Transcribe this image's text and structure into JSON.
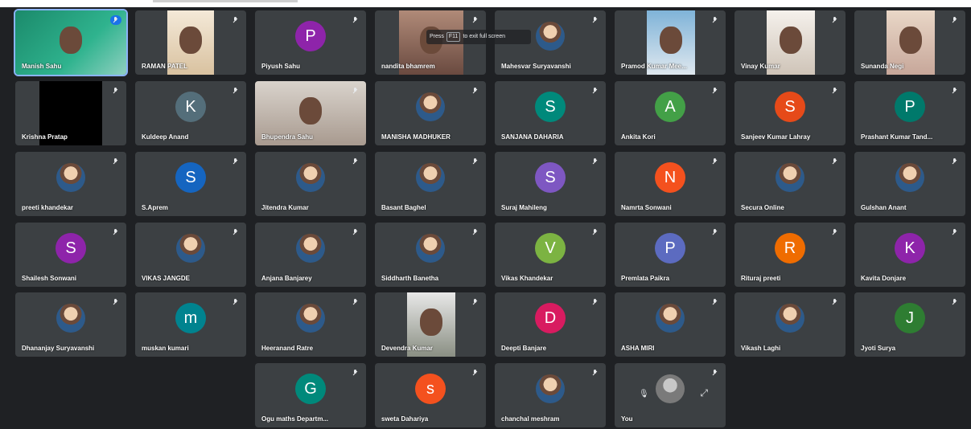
{
  "tooltip": {
    "prefix": "Press",
    "key": "F11",
    "suffix": "to exit full screen"
  },
  "participants": [
    {
      "name": "Manish Sahu",
      "kind": "video"
    },
    {
      "name": "RAMAN PATEL",
      "kind": "video"
    },
    {
      "name": "Piyush Sahu",
      "kind": "initial",
      "initial": "P",
      "color": "#8e24aa"
    },
    {
      "name": "nandita bhamrem",
      "kind": "video"
    },
    {
      "name": "Mahesvar Suryavanshi",
      "kind": "photo"
    },
    {
      "name": "Pramod Kumar Mee...",
      "kind": "video"
    },
    {
      "name": "Vinay Kumar",
      "kind": "video"
    },
    {
      "name": "Sunanda Negi",
      "kind": "video"
    },
    {
      "name": "Krishna Pratap",
      "kind": "black"
    },
    {
      "name": "Kuldeep Anand",
      "kind": "initial",
      "initial": "K",
      "color": "#546e7a"
    },
    {
      "name": "Bhupendra Sahu",
      "kind": "video"
    },
    {
      "name": "MANISHA MADHUKER",
      "kind": "photo"
    },
    {
      "name": "SANJANA DAHARIA",
      "kind": "initial",
      "initial": "S",
      "color": "#00897b"
    },
    {
      "name": "Ankita Kori",
      "kind": "initial",
      "initial": "A",
      "color": "#43a047"
    },
    {
      "name": "Sanjeev Kumar Lahray",
      "kind": "initial",
      "initial": "S",
      "color": "#e64a19"
    },
    {
      "name": "Prashant Kumar Tand...",
      "kind": "initial",
      "initial": "P",
      "color": "#00796b"
    },
    {
      "name": "preeti khandekar",
      "kind": "photo"
    },
    {
      "name": "S.Aprem",
      "kind": "initial",
      "initial": "S",
      "color": "#1565c0"
    },
    {
      "name": "Jitendra Kumar",
      "kind": "photo"
    },
    {
      "name": "Basant Baghel",
      "kind": "photo"
    },
    {
      "name": "Suraj Mahileng",
      "kind": "initial",
      "initial": "S",
      "color": "#7e57c2"
    },
    {
      "name": "Namrta Sonwani",
      "kind": "initial",
      "initial": "N",
      "color": "#f4511e"
    },
    {
      "name": "Secura Online",
      "kind": "photo"
    },
    {
      "name": "Gulshan Anant",
      "kind": "photo"
    },
    {
      "name": "Shailesh Sonwani",
      "kind": "initial",
      "initial": "S",
      "color": "#8e24aa"
    },
    {
      "name": "VIKAS JANGDE",
      "kind": "photo"
    },
    {
      "name": "Anjana Banjarey",
      "kind": "photo"
    },
    {
      "name": "Siddharth Banetha",
      "kind": "photo"
    },
    {
      "name": "Vikas Khandekar",
      "kind": "initial",
      "initial": "V",
      "color": "#7cb342"
    },
    {
      "name": "Premlata Paikra",
      "kind": "initial",
      "initial": "P",
      "color": "#5c6bc0"
    },
    {
      "name": "Rituraj preeti",
      "kind": "initial",
      "initial": "R",
      "color": "#ef6c00"
    },
    {
      "name": "Kavita Donjare",
      "kind": "initial",
      "initial": "K",
      "color": "#8e24aa"
    },
    {
      "name": "Dhananjay Suryavanshi",
      "kind": "photo"
    },
    {
      "name": "muskan kumari",
      "kind": "initial",
      "initial": "m",
      "color": "#00838f"
    },
    {
      "name": "Heeranand Ratre",
      "kind": "photo"
    },
    {
      "name": "Devendra Kumar",
      "kind": "video"
    },
    {
      "name": "Deepti Banjare",
      "kind": "initial",
      "initial": "D",
      "color": "#d81b60"
    },
    {
      "name": "ASHA MIRI",
      "kind": "photo"
    },
    {
      "name": "Vikash Laghi",
      "kind": "photo"
    },
    {
      "name": "Jyoti Surya",
      "kind": "initial",
      "initial": "J",
      "color": "#2e7d32"
    },
    {
      "name": "Ogu maths Departm...",
      "kind": "initial",
      "initial": "G",
      "color": "#00897b"
    },
    {
      "name": "sweta Dahariya",
      "kind": "initial",
      "initial": "s",
      "color": "#f4511e"
    },
    {
      "name": "chanchal meshram",
      "kind": "photo"
    },
    {
      "name": "You",
      "kind": "self"
    }
  ]
}
